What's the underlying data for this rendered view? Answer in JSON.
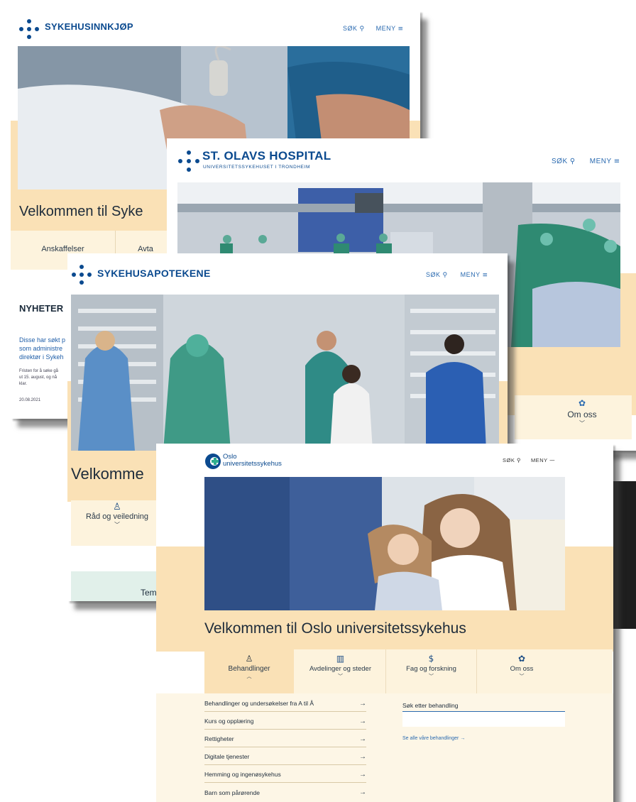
{
  "cards": {
    "sykehusinnkjop": {
      "brand": "SYKEHUSINNKJØP",
      "nav_search": "SØK",
      "nav_menu": "MENY",
      "welcome": "Velkommen til Syke",
      "tabs": [
        "Anskaffelser",
        "Avta"
      ],
      "news_heading": "NYHETER",
      "news_lines": [
        "Disse har søkt p",
        "som administre",
        "direktør i Sykeh"
      ],
      "news_body": [
        "Fristen for å søke gå",
        "ut 15. august, og nå",
        "klar."
      ],
      "news_date": "20.08.2021"
    },
    "st_olavs": {
      "brand": "ST. OLAVS HOSPITAL",
      "subtitle": "UNIVERSITETSSYKEHUSET I TRONDHEIM",
      "nav_search": "SØK",
      "nav_menu": "MENY",
      "tile_label": "Om oss"
    },
    "sykehusapotekene": {
      "brand": "SYKEHUSAPOTEKENE",
      "nav_search": "SØK",
      "nav_menu": "MENY",
      "welcome": "Velkomme",
      "tile_label": "Råd og veiledning",
      "bottom_label": "Tem"
    },
    "ous": {
      "brand_line1": "Oslo",
      "brand_line2": "universitetssykehus",
      "nav_search": "SØK",
      "nav_menu": "MENY",
      "welcome": "Velkommen til Oslo universitetssykehus",
      "tabs": [
        {
          "label": "Behandlinger",
          "icon": "person-icon"
        },
        {
          "label": "Avdelinger og steder",
          "icon": "building-icon"
        },
        {
          "label": "Fag og forskning",
          "icon": "money-icon"
        },
        {
          "label": "Om oss",
          "icon": "flower-icon"
        }
      ],
      "links": [
        "Behandlinger og undersøkelser fra A til Å",
        "Kurs og opplæring",
        "Rettigheter",
        "Digitale tjenester",
        "Hemming og ingenøsykehus",
        "Barn som pårørende"
      ],
      "search_label": "Søk etter behandling",
      "search_placeholder": "",
      "search_hint": "Se alle våre behandlinger"
    }
  },
  "colors": {
    "brand_blue": "#0b4a8f",
    "peach": "#fae1b6",
    "cream": "#fdf3dd"
  }
}
